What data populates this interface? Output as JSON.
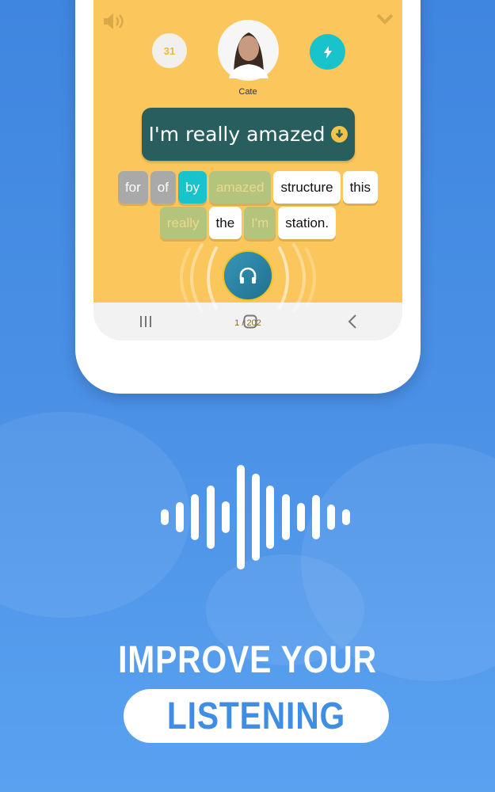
{
  "app": {
    "score": "31",
    "speaker_name": "Cate",
    "sentence": "I'm really amazed",
    "word_rows": [
      [
        {
          "text": "for",
          "state": "gray"
        },
        {
          "text": "of",
          "state": "gray"
        },
        {
          "text": "by",
          "state": "teal"
        },
        {
          "text": "amazed",
          "state": "green"
        },
        {
          "text": "structure",
          "state": "white"
        },
        {
          "text": "this",
          "state": "white"
        }
      ],
      [
        {
          "text": "really",
          "state": "green"
        },
        {
          "text": "the",
          "state": "white"
        },
        {
          "text": "I'm",
          "state": "green"
        },
        {
          "text": "station.",
          "state": "white"
        }
      ]
    ],
    "progress": "1 / 202",
    "icons": {
      "sound": "speaker-icon",
      "collapse": "chevron-down-icon",
      "boost": "lightning-icon",
      "listen": "headphones-icon",
      "sentence_action": "arrow-down-circle-icon"
    }
  },
  "promo": {
    "line1": "IMPROVE YOUR",
    "line2": "LISTENING"
  },
  "colors": {
    "background": "#4a90e6",
    "screen": "#fbc75c",
    "sentence_bg": "#285e5e",
    "teal": "#18c3cc",
    "headphones_btn": "#2a7fa0"
  }
}
